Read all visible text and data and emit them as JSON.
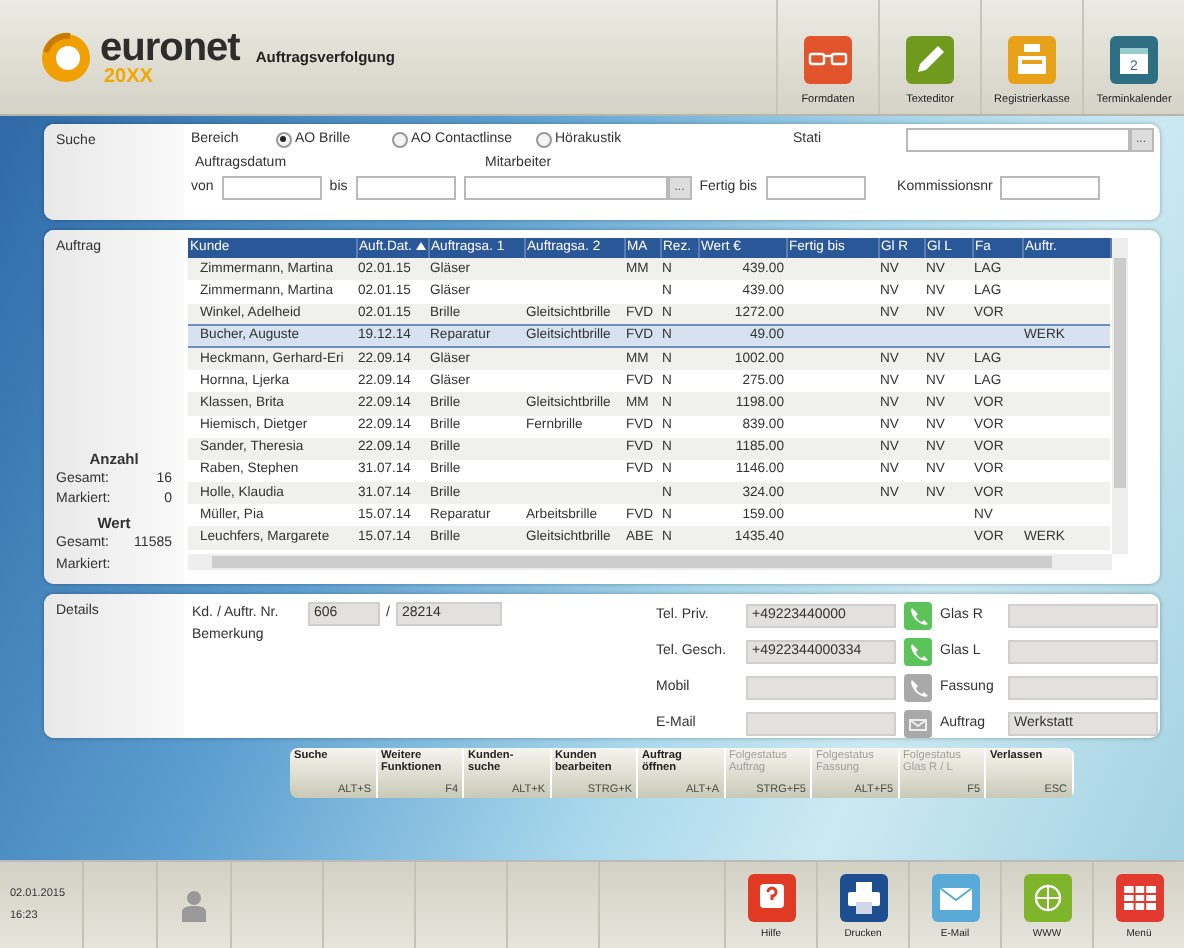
{
  "app": {
    "logo_name": "euronet",
    "logo_edition": "20XX",
    "title": "Auftragsverfolgung"
  },
  "toolbar": [
    {
      "label": "Formdaten"
    },
    {
      "label": "Texteditor"
    },
    {
      "label": "Registrierkasse"
    },
    {
      "label": "Terminkalender",
      "day": "2"
    }
  ],
  "search": {
    "label": "Suche",
    "bereich_label": "Bereich",
    "options": [
      {
        "label": "AO Brille",
        "selected": true
      },
      {
        "label": "AO Contactlinse",
        "selected": false
      },
      {
        "label": "Hörakustik",
        "selected": false
      }
    ],
    "stati_label": "Stati",
    "auftragsdatum_label": "Auftragsdatum",
    "mitarbeiter_label": "Mitarbeiter",
    "von_label": "von",
    "bis_label": "bis",
    "fertig_label": "Fertig bis",
    "kommission_label": "Kommissionsnr",
    "more_button": "...",
    "more_button_2": "..."
  },
  "orders": {
    "label": "Auftrag",
    "anzahl_label": "Anzahl",
    "anzahl_gesamt_label": "Gesamt:",
    "anzahl_gesamt": "16",
    "anzahl_markiert_label": "Markiert:",
    "anzahl_markiert": "0",
    "wert_label": "Wert",
    "wert_gesamt_label": "Gesamt:",
    "wert_gesamt": "11585",
    "wert_markiert_label": "Markiert:",
    "columns": [
      {
        "label": "Kunde",
        "sorted": false
      },
      {
        "label": "Auft.Dat.",
        "sorted": true
      },
      {
        "label": "Auftragsa. 1",
        "sorted": false
      },
      {
        "label": "Auftragsa. 2",
        "sorted": false
      },
      {
        "label": "MA",
        "sorted": false
      },
      {
        "label": "Rez.",
        "sorted": false
      },
      {
        "label": "Wert €",
        "sorted": false
      },
      {
        "label": "Fertig bis",
        "sorted": false
      },
      {
        "label": "Gl R",
        "sorted": false
      },
      {
        "label": "Gl L",
        "sorted": false
      },
      {
        "label": "Fa",
        "sorted": false
      },
      {
        "label": "Auftr.",
        "sorted": false
      }
    ],
    "rows": [
      {
        "cells": [
          "Zimmermann, Martina",
          "02.01.15",
          "Gläser",
          "",
          "MM",
          "N",
          "439.00",
          "",
          "NV",
          "NV",
          "LAG",
          ""
        ],
        "selected": false
      },
      {
        "cells": [
          "Zimmermann, Martina",
          "02.01.15",
          "Gläser",
          "",
          "",
          "N",
          "439.00",
          "",
          "NV",
          "NV",
          "LAG",
          ""
        ],
        "selected": false
      },
      {
        "cells": [
          "Winkel, Adelheid",
          "02.01.15",
          "Brille",
          "Gleitsichtbrille",
          "FVD",
          "N",
          "1272.00",
          "",
          "NV",
          "NV",
          "VOR",
          ""
        ],
        "selected": false
      },
      {
        "cells": [
          "Bucher, Auguste",
          "19.12.14",
          "Reparatur",
          "Gleitsichtbrille",
          "FVD",
          "N",
          "49.00",
          "",
          "",
          "",
          "",
          "WERK"
        ],
        "selected": true
      },
      {
        "cells": [
          "Heckmann, Gerhard-Eri",
          "22.09.14",
          "Gläser",
          "",
          "MM",
          "N",
          "1002.00",
          "",
          "NV",
          "NV",
          "LAG",
          ""
        ],
        "selected": false
      },
      {
        "cells": [
          "Hornna, Ljerka",
          "22.09.14",
          "Gläser",
          "",
          "FVD",
          "N",
          "275.00",
          "",
          "NV",
          "NV",
          "LAG",
          ""
        ],
        "selected": false
      },
      {
        "cells": [
          "Klassen, Brita",
          "22.09.14",
          "Brille",
          "Gleitsichtbrille",
          "MM",
          "N",
          "1198.00",
          "",
          "NV",
          "NV",
          "VOR",
          ""
        ],
        "selected": false
      },
      {
        "cells": [
          "Hiemisch, Dietger",
          "22.09.14",
          "Brille",
          "Fernbrille",
          "FVD",
          "N",
          "839.00",
          "",
          "NV",
          "NV",
          "VOR",
          ""
        ],
        "selected": false
      },
      {
        "cells": [
          "Sander, Theresia",
          "22.09.14",
          "Brille",
          "",
          "FVD",
          "N",
          "1185.00",
          "",
          "NV",
          "NV",
          "VOR",
          ""
        ],
        "selected": false
      },
      {
        "cells": [
          "Raben, Stephen",
          "31.07.14",
          "Brille",
          "",
          "FVD",
          "N",
          "1146.00",
          "",
          "NV",
          "NV",
          "VOR",
          ""
        ],
        "selected": false
      },
      {
        "cells": [
          "Holle, Klaudia",
          "31.07.14",
          "Brille",
          "",
          "",
          "N",
          "324.00",
          "",
          "NV",
          "NV",
          "VOR",
          ""
        ],
        "selected": false
      },
      {
        "cells": [
          "Müller, Pia",
          "15.07.14",
          "Reparatur",
          "Arbeitsbrille",
          "FVD",
          "N",
          "159.00",
          "",
          "",
          "",
          "NV",
          ""
        ],
        "selected": false
      },
      {
        "cells": [
          "Leuchfers, Margarete",
          "15.07.14",
          "Brille",
          "Gleitsichtbrille",
          "ABE",
          "N",
          "1435.40",
          "",
          "",
          "",
          "VOR",
          "WERK"
        ],
        "selected": false
      }
    ]
  },
  "details": {
    "label": "Details",
    "nr_label": "Kd. / Auftr. Nr.",
    "kunde_nr": "606",
    "sep": "/",
    "auftrag_nr": "28214",
    "bemerkung_label": "Bemerkung",
    "contacts": [
      {
        "label": "Tel. Priv.",
        "value": "+49223440000",
        "kind": "phone",
        "active": true
      },
      {
        "label": "Tel. Gesch.",
        "value": "+4922344000334",
        "kind": "phone",
        "active": true
      },
      {
        "label": "Mobil",
        "kind": "phone",
        "active": false
      },
      {
        "label": "E-Mail",
        "kind": "mail",
        "active": false
      }
    ],
    "status": [
      {
        "label": "Glas R"
      },
      {
        "label": "Glas L"
      },
      {
        "label": "Fassung"
      },
      {
        "label": "Auftrag",
        "value": "Werkstatt"
      }
    ]
  },
  "function_keys": [
    {
      "label": "Suche",
      "key": "ALT+S",
      "disabled": false
    },
    {
      "label": "Weitere Funktionen",
      "key": "F4",
      "disabled": false
    },
    {
      "label": "Kunden-suche",
      "key": "ALT+K",
      "disabled": false
    },
    {
      "label": "Kunden bearbeiten",
      "key": "STRG+K",
      "disabled": false
    },
    {
      "label": "Auftrag öffnen",
      "key": "ALT+A",
      "disabled": false
    },
    {
      "label": "Folgestatus Auftrag",
      "key": "STRG+F5",
      "disabled": true
    },
    {
      "label": "Folgestatus Fassung",
      "key": "ALT+F5",
      "disabled": true
    },
    {
      "label": "Folgestatus Glas R / L",
      "key": "F5",
      "disabled": true
    },
    {
      "label": "Verlassen",
      "key": "ESC",
      "disabled": false
    }
  ],
  "footer": {
    "date": "02.01.2015",
    "time": "16:23",
    "buttons": [
      {
        "label": "Hilfe"
      },
      {
        "label": "Drucken"
      },
      {
        "label": "E-Mail"
      },
      {
        "label": "WWW"
      },
      {
        "label": "Menü"
      }
    ]
  }
}
